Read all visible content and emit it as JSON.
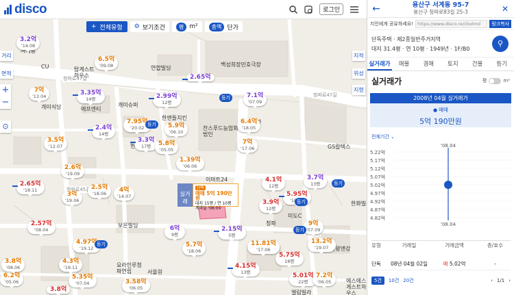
{
  "topbar": {
    "logo": "disco",
    "login": "로그인"
  },
  "filters": {
    "type_label": "전체유형",
    "view_label": "보기조건",
    "unit_a": "평",
    "unit_b": "m²",
    "price_toggle": "총액",
    "price_alt": "단가"
  },
  "side_tabs": {
    "left_top": "거리",
    "left_mid": "면적",
    "right_top": "지적",
    "right_mid": "위성",
    "right_low": "지형"
  },
  "places": [
    {
      "text": "서계동"
    },
    {
      "text": "연합빌딩"
    },
    {
      "text": "백성희장민호극장"
    },
    {
      "text": "탑게스트하우스"
    },
    {
      "text": "CU"
    },
    {
      "text": "개미식당"
    },
    {
      "text": "에프엔티"
    },
    {
      "text": "개미슈퍼"
    },
    {
      "text": "한앤들치킨"
    },
    {
      "text": "찬스푸드농업회사법인"
    },
    {
      "text": "데렌터카"
    },
    {
      "text": "현대오피스텔"
    },
    {
      "text": "이마트24"
    },
    {
      "text": "GS칼텍스"
    },
    {
      "text": "보은빌딩"
    },
    {
      "text": "미도C"
    },
    {
      "text": "청파"
    },
    {
      "text": "요라인루청파연립"
    },
    {
      "text": "서울원"
    },
    {
      "text": "엘림빌라"
    },
    {
      "text": "에스에스게스트하우스"
    },
    {
      "text": "한화빌라"
    },
    {
      "text": "인왕앤강"
    }
  ],
  "road_labels": [
    "청파로47길",
    "청파로45길",
    "청파로47길"
  ],
  "pins": [
    {
      "price": "3.2억",
      "date": "'14.08",
      "color": "purple"
    },
    {
      "price": "6.5억",
      "date": "'09.08",
      "color": "orange"
    },
    {
      "price": "2.65억",
      "date": "",
      "color": "purple"
    },
    {
      "price": "3.35억",
      "date": "14평",
      "color": "purple"
    },
    {
      "price": "7억",
      "date": "'13.04",
      "color": "orange"
    },
    {
      "price": "2.99억",
      "date": "12평",
      "color": "purple"
    },
    {
      "price": "7.1억",
      "date": "'07.09",
      "color": "purple"
    },
    {
      "price": "2.4억",
      "date": "14평",
      "color": "purple"
    },
    {
      "price": "7.95억",
      "date": "'20.02",
      "color": "orange"
    },
    {
      "price": "5.9억",
      "date": "'06.10",
      "color": "orange"
    },
    {
      "price": "6.4억",
      "date": "'18.05",
      "color": "orange"
    },
    {
      "price": "3.5억",
      "date": "'12.07",
      "color": "orange"
    },
    {
      "price": "3.3억",
      "date": "17평",
      "color": "purple"
    },
    {
      "price": "5.8억",
      "date": "'05.05",
      "color": "orange"
    },
    {
      "price": "7억",
      "date": "'17.06",
      "color": "orange"
    },
    {
      "price": "2.6억",
      "date": "'19.09",
      "color": "orange"
    },
    {
      "price": "1.39억",
      "date": "'06.06",
      "color": "orange"
    },
    {
      "price": "2.65억",
      "date": "'18.11",
      "color": "red"
    },
    {
      "price": "2.5억",
      "date": "'18.06",
      "color": "orange"
    },
    {
      "price": "4억",
      "date": "'14.07",
      "color": "orange"
    },
    {
      "price": "3억",
      "date": "'19.06",
      "color": "orange"
    },
    {
      "price": "4.1억",
      "date": "12평",
      "color": "red"
    },
    {
      "price": "3.7억",
      "date": "13평",
      "color": "purple"
    },
    {
      "price": "5.95억",
      "date": "'18.05",
      "color": "red"
    },
    {
      "price": "3.9억",
      "date": "12평",
      "color": "red"
    },
    {
      "price": "2.57억",
      "date": "'08.04",
      "color": "red"
    },
    {
      "price": "6억",
      "date": "9평",
      "color": "purple"
    },
    {
      "price": "2.15억",
      "date": "5평",
      "color": "purple"
    },
    {
      "price": "9억",
      "date": "'07.09",
      "color": "orange"
    },
    {
      "price": "4.97억",
      "date": "'19.12",
      "color": "orange"
    },
    {
      "price": "5.7억",
      "date": "'18.06",
      "color": "orange"
    },
    {
      "price": "11.81억",
      "date": "'17.06",
      "color": "orange"
    },
    {
      "price": "13.2억",
      "date": "'19.07",
      "color": "orange"
    },
    {
      "price": "3.8억",
      "date": "'08.06",
      "color": "orange"
    },
    {
      "price": "4.3억",
      "date": "'19.11",
      "color": "orange"
    },
    {
      "price": "5.75억",
      "date": "18평",
      "color": "red"
    },
    {
      "price": "4.15억",
      "date": "13평",
      "color": "red"
    },
    {
      "price": "6.2억",
      "date": "'05.06",
      "color": "orange"
    },
    {
      "price": "5.35억",
      "date": "'07.04",
      "color": "orange"
    },
    {
      "price": "3.58억",
      "date": "'06.05",
      "color": "orange"
    },
    {
      "price": "5.01억",
      "date": "22평",
      "color": "red"
    },
    {
      "price": "7.2억",
      "date": "'06.05",
      "color": "orange"
    },
    {
      "price": "3.8억",
      "date": "",
      "color": "red"
    }
  ],
  "tags": [
    "등기",
    "등기",
    "등기",
    "등기",
    "등기",
    "등기"
  ],
  "selected": {
    "left_label": "실거래",
    "badge": "단독",
    "trade": "매매 5억 190만원",
    "line2": "대지 15평 / 연 10평",
    "line3": "계약일 '08.04"
  },
  "panel": {
    "title": "용산구 서계동 95-7",
    "subtitle": "용산구 청파로83길 25-3",
    "share_label": "지인에게 공유하세요!",
    "share_url": "https://www.disco.re/cbxlmd",
    "copy": "링크복사",
    "info1": "단독주택 · 제2종일반주거지역",
    "info2": "대지 31.4평 · 연 10평 · 1949년 · 1F/B0",
    "tabs": [
      "실거래가",
      "매물",
      "경매",
      "토지",
      "건물",
      "등기"
    ],
    "section_title": "실거래가",
    "unit_left": "평",
    "unit_right": "m²",
    "month_banner": "2008년 04월 실거래가",
    "trade_type": "매매",
    "trade_price": "5억 190만원",
    "period": "전체기간",
    "table_headers": [
      "유형",
      "거래일",
      "거래금액",
      "층/호수"
    ],
    "table_rows": [
      {
        "type": "단독",
        "date": "08년 04월 02일",
        "kind": "매",
        "amount": "5.02억",
        "floor": "-"
      }
    ],
    "pager_tabs": [
      "5건",
      "10건",
      "20건"
    ],
    "page": "1/1"
  },
  "chart_data": {
    "type": "scatter",
    "y_ticks": [
      "5.22억",
      "5.17억",
      "5.12억",
      "5.07억",
      "5.02억",
      "4.97억",
      "4.92억",
      "4.87억",
      "4.82억"
    ],
    "x_top": "'08.04",
    "x_bottom": "'08.04",
    "points": [
      {
        "x": "'08.04",
        "y": 5.02
      }
    ],
    "ylim": [
      4.8,
      5.22
    ],
    "color": "#1a56c4"
  }
}
